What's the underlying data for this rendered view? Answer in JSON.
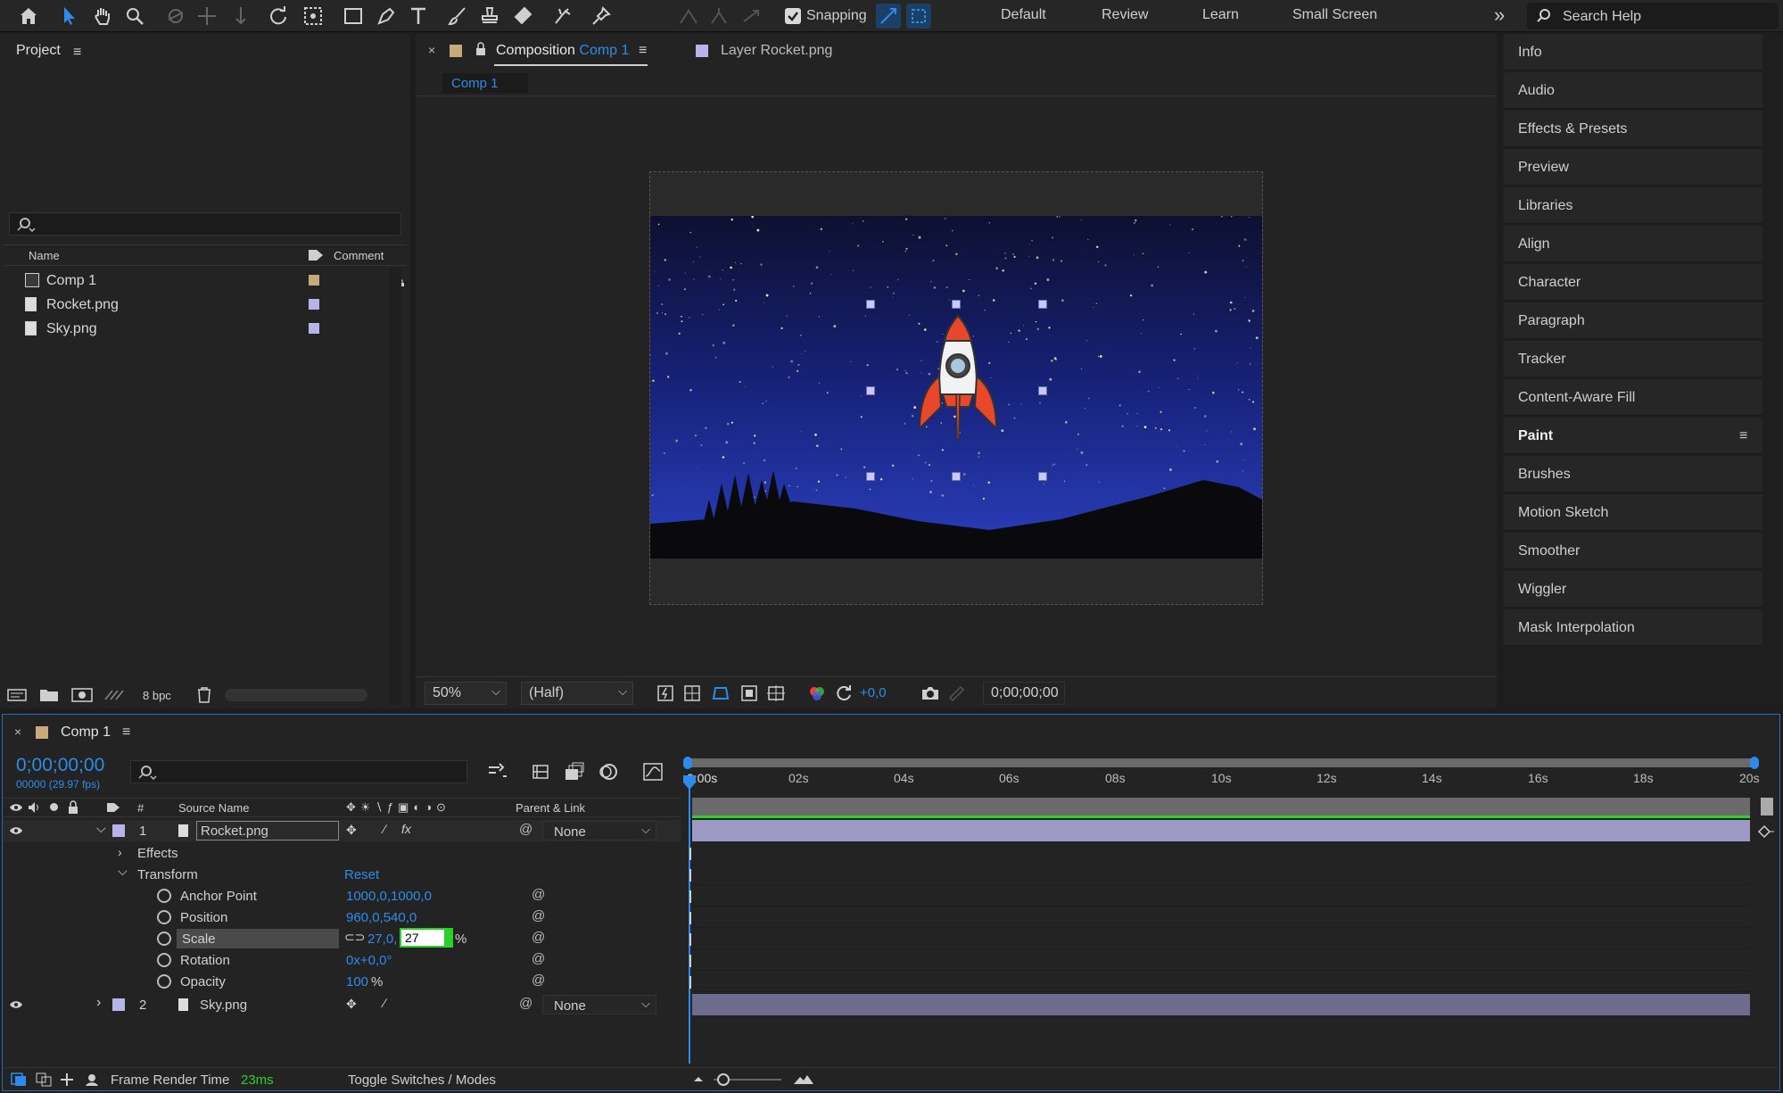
{
  "toolbar": {
    "snapping_label": "Snapping",
    "workspaces": [
      "Default",
      "Review",
      "Learn",
      "Small Screen"
    ],
    "overflow_label": "»",
    "search_placeholder": "Search Help"
  },
  "project": {
    "title": "Project",
    "columns": {
      "name": "Name",
      "comment": "Comment"
    },
    "items": [
      {
        "name": "Comp 1",
        "type": "composition",
        "label_color": "#c8a97a"
      },
      {
        "name": "Rocket.png",
        "type": "footage",
        "label_color": "#b6b4e8"
      },
      {
        "name": "Sky.png",
        "type": "footage",
        "label_color": "#b6b4e8"
      }
    ],
    "bpc": "8 bpc"
  },
  "viewer": {
    "tab_composition_prefix": "Composition",
    "tab_composition_name": "Comp 1",
    "tab_layer": "Layer Rocket.png",
    "breadcrumb": "Comp 1",
    "zoom": "50%",
    "resolution": "(Half)",
    "exposure": "+0,0",
    "timecode": "0;00;00;00"
  },
  "right_panels": [
    "Info",
    "Audio",
    "Effects & Presets",
    "Preview",
    "Libraries",
    "Align",
    "Character",
    "Paragraph",
    "Tracker",
    "Content-Aware Fill",
    "Paint",
    "Brushes",
    "Motion Sketch",
    "Smoother",
    "Wiggler",
    "Mask Interpolation"
  ],
  "timeline": {
    "tab": "Comp 1",
    "timecode": "0;00;00;00",
    "frame_info": "00000 (29.97 fps)",
    "columns": {
      "num": "#",
      "source": "Source Name",
      "parent": "Parent & Link"
    },
    "ticks": [
      "0:00s",
      "02s",
      "04s",
      "06s",
      "08s",
      "10s",
      "12s",
      "14s",
      "16s",
      "18s",
      "20s"
    ],
    "layers": [
      {
        "num": "1",
        "name": "Rocket.png",
        "parent": "None"
      },
      {
        "num": "2",
        "name": "Sky.png",
        "parent": "None"
      }
    ],
    "effects_label": "Effects",
    "transform_label": "Transform",
    "reset_label": "Reset",
    "props": {
      "anchor": {
        "label": "Anchor Point",
        "value": "1000,0,1000,0"
      },
      "position": {
        "label": "Position",
        "value": "960,0,540,0"
      },
      "scale": {
        "label": "Scale",
        "value_x": "27,0,",
        "value_edit": "27",
        "unit": "%"
      },
      "rotation": {
        "label": "Rotation",
        "value": "0x+0,0°"
      },
      "opacity": {
        "label": "Opacity",
        "value": "100",
        "unit": "%"
      }
    },
    "frame_render_label": "Frame Render Time",
    "frame_render_value": "23ms",
    "toggle_label": "Toggle Switches / Modes"
  },
  "colors": {
    "accent": "#2d8ceb",
    "highlight_green": "#2bd12b",
    "panel": "#232323"
  }
}
